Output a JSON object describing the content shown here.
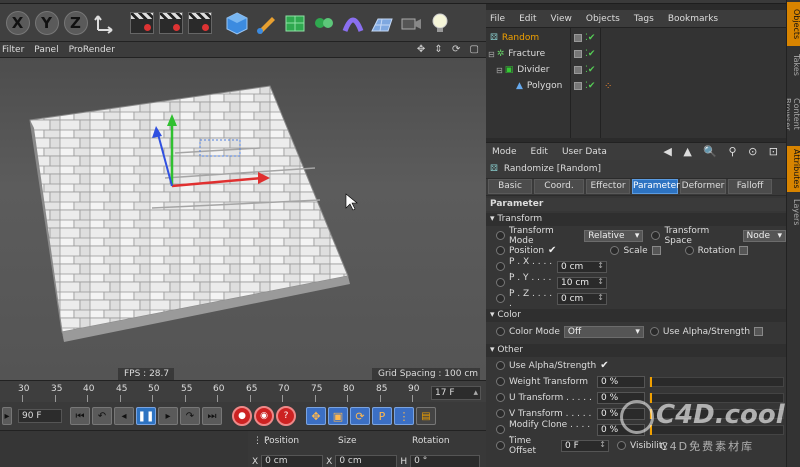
{
  "toolbar": {
    "axis_x": "X",
    "axis_y": "Y",
    "axis_z": "Z"
  },
  "viewport_menu": [
    "Filter",
    "Panel",
    "ProRender"
  ],
  "viewport": {
    "fps": "FPS : 28.7",
    "grid_spacing": "Grid Spacing : 100 cm"
  },
  "timeline": {
    "ticks": [
      "30",
      "35",
      "40",
      "45",
      "50",
      "55",
      "60",
      "65",
      "70",
      "75",
      "80",
      "85",
      "90"
    ],
    "end_frame": "17 F",
    "start_frame": "90 F"
  },
  "coordinates": {
    "position_label": "Position",
    "size_label": "Size",
    "rotation_label": "Rotation",
    "pos_x_axis": "X",
    "pos_x_val": "0 cm",
    "size_x_axis": "X",
    "size_x_val": "0 cm",
    "rot_h_axis": "H",
    "rot_h_val": "0 °"
  },
  "object_manager": {
    "menu": [
      "File",
      "Edit",
      "View",
      "Objects",
      "Tags",
      "Bookmarks"
    ],
    "objects": [
      {
        "name": "Random",
        "active": true
      },
      {
        "name": "Fracture",
        "active": false
      },
      {
        "name": "Divider",
        "active": false
      },
      {
        "name": "Polygon",
        "active": false
      }
    ]
  },
  "attributes": {
    "menu": [
      "Mode",
      "Edit",
      "User Data"
    ],
    "title": "Randomize [Random]",
    "tabs": [
      "Basic",
      "Coord.",
      "Effector",
      "Parameter",
      "Deformer",
      "Falloff"
    ],
    "active_tab": "Parameter",
    "section_main": "Parameter",
    "transform": {
      "header": "Transform",
      "mode_label": "Transform Mode",
      "mode_value": "Relative",
      "space_label": "Transform Space",
      "space_value": "Node",
      "position_label": "Position",
      "position_check": "✔",
      "scale_label": "Scale",
      "rotation_label": "Rotation",
      "px_label": "P . X . . . . .",
      "px_value": "0 cm",
      "py_label": "P . Y . . . . .",
      "py_value": "10 cm",
      "pz_label": "P . Z . . . . .",
      "pz_value": "0 cm"
    },
    "color": {
      "header": "Color",
      "mode_label": "Color Mode",
      "mode_value": "Off",
      "alpha_label": "Use Alpha/Strength"
    },
    "other": {
      "header": "Other",
      "alpha_label": "Use Alpha/Strength",
      "alpha_check": "✔",
      "weight_label": "Weight Transform",
      "weight_value": "0 %",
      "weight_level": 0,
      "u_label": "U Transform . . . . .",
      "u_value": "0 %",
      "u_level": 0,
      "v_label": "V Transform . . . . .",
      "v_value": "0 %",
      "v_level": 0,
      "clone_label": "Modify Clone . . . . .",
      "clone_value": "0 %",
      "clone_level": 0,
      "time_label": "Time Offset",
      "time_value": "0 F",
      "visibility_label": "Visibility"
    }
  },
  "side_tabs": [
    "Objects",
    "Takes",
    "Content Browser",
    "Attributes",
    "Layers"
  ],
  "watermark": {
    "logo": "C4D.cool",
    "sub": "C4D免费素材库"
  },
  "colors": {
    "accent_orange": "#f0a000",
    "tab_active": "#2d73c2",
    "axis_x": "#e03030",
    "axis_y": "#30c030",
    "axis_z": "#3050e0"
  }
}
